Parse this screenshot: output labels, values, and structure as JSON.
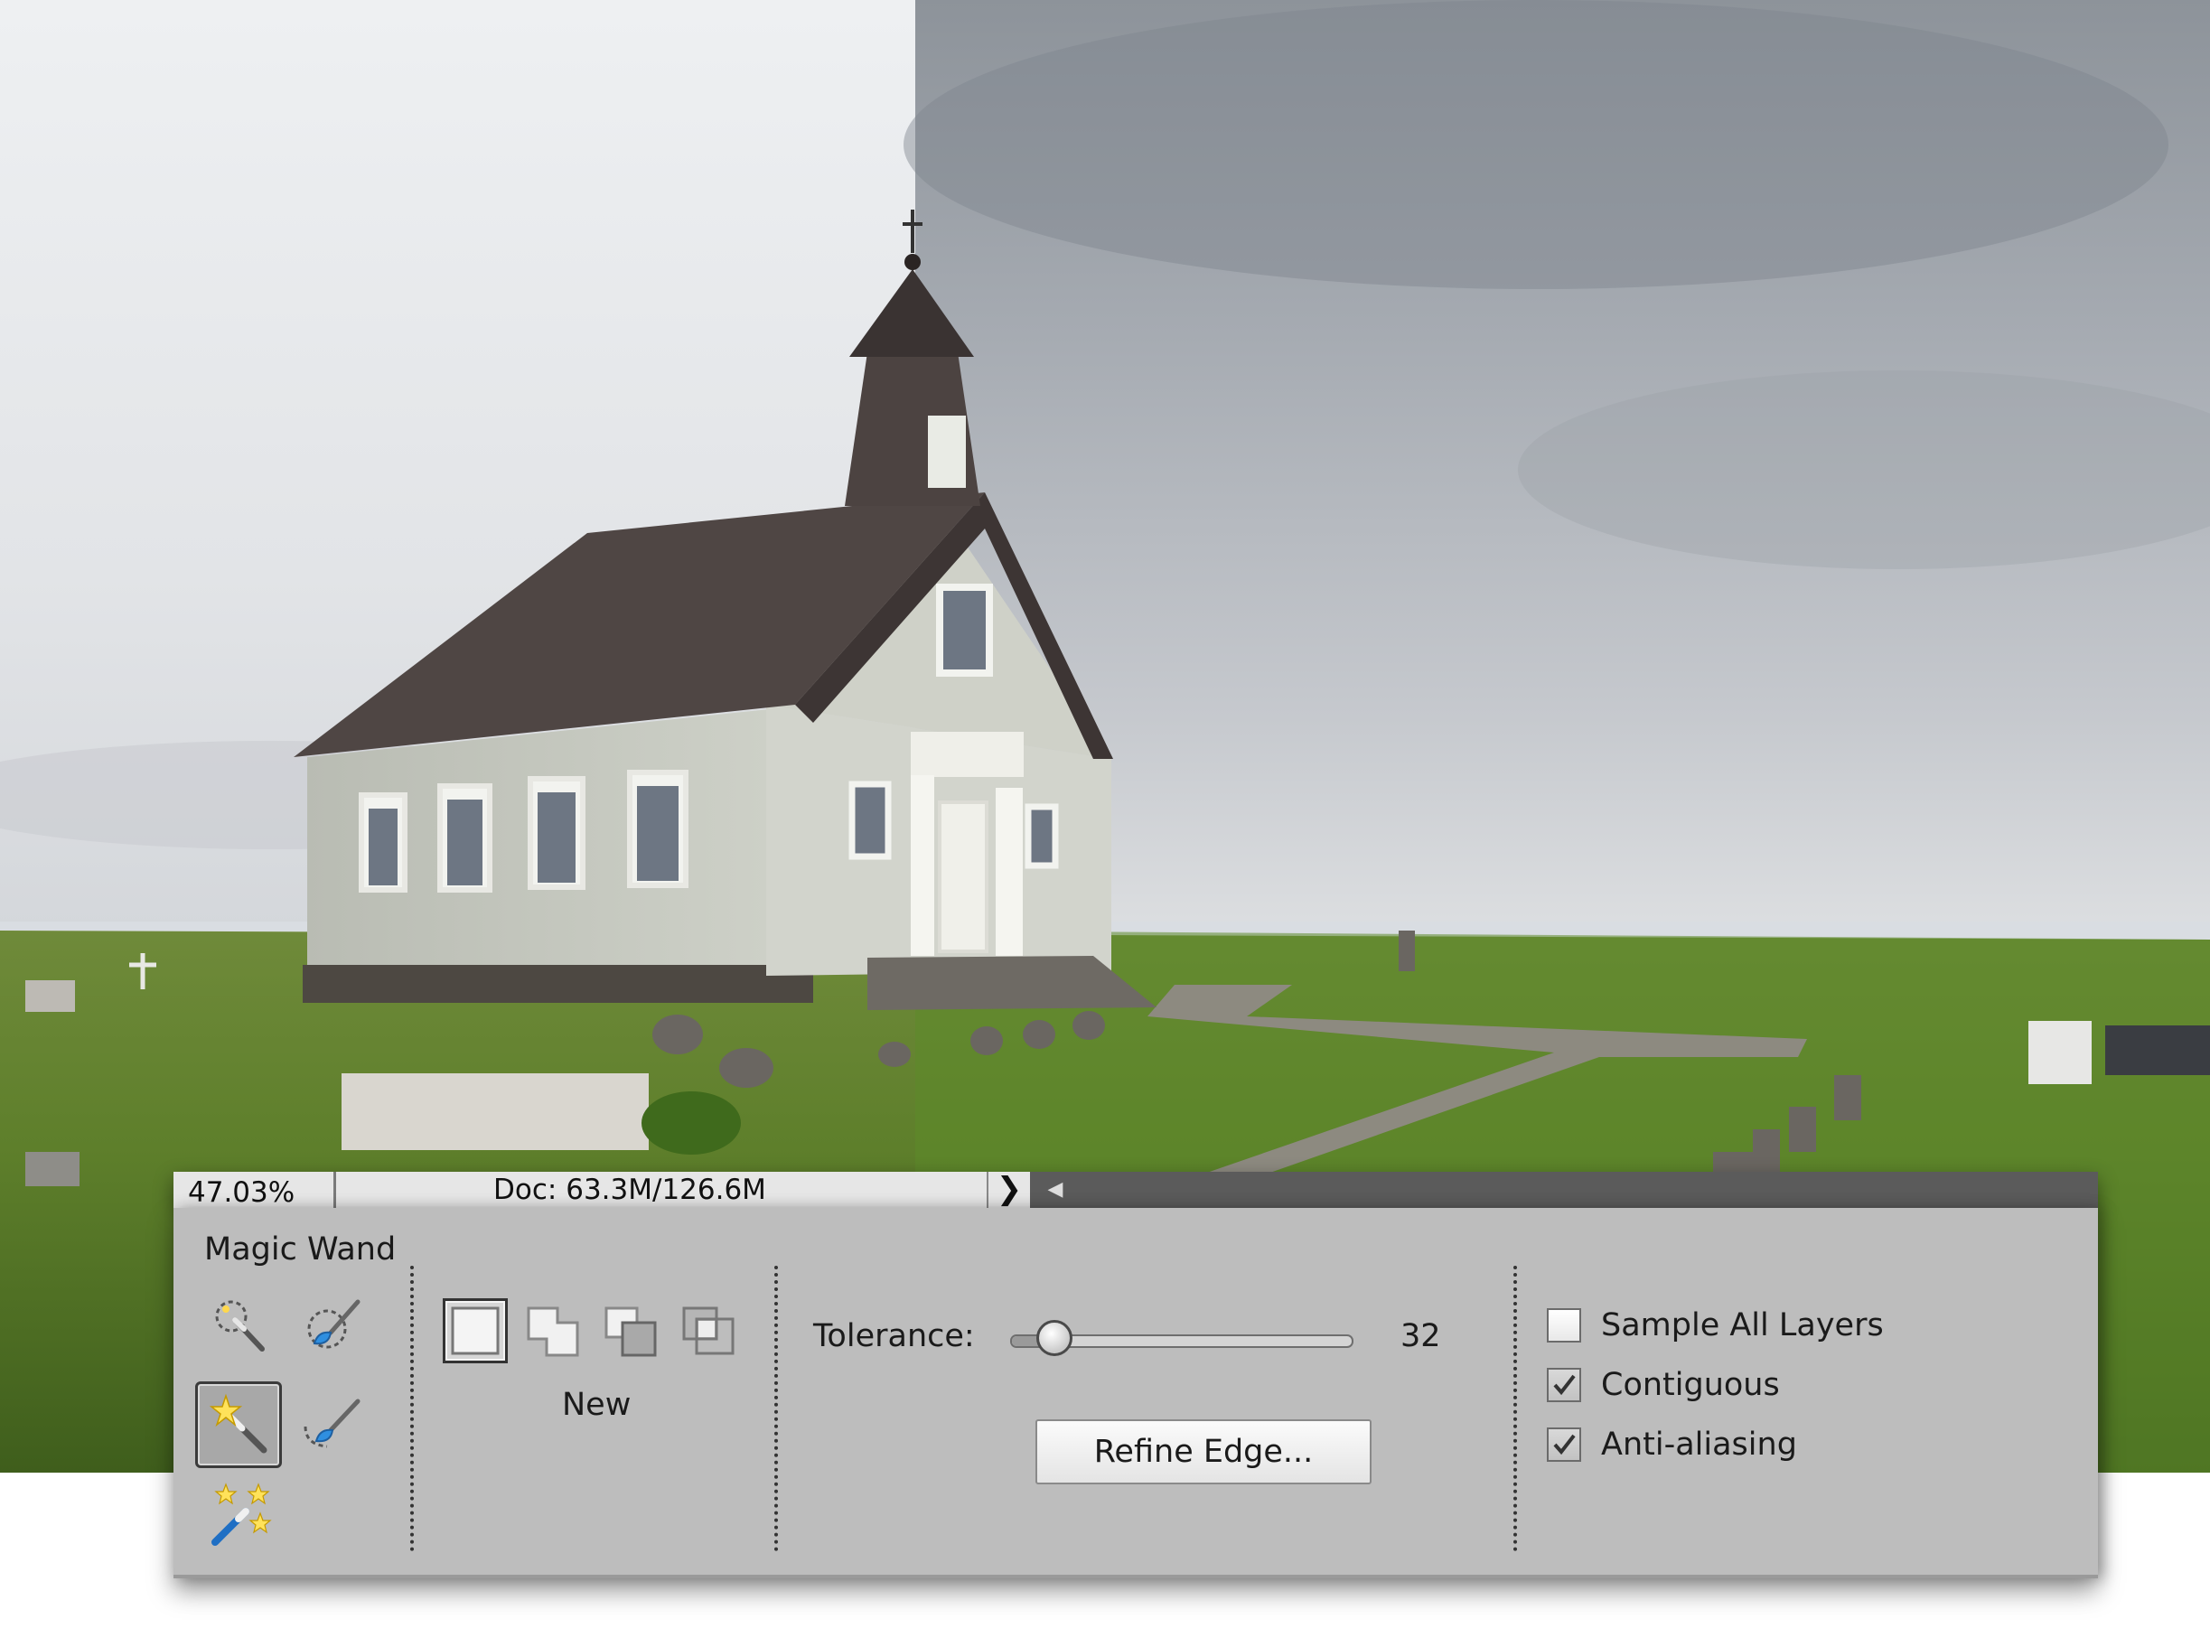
{
  "statusbar": {
    "zoom": "47.03%",
    "doc_size": "Doc: 63.3M/126.6M",
    "arrow": "❯",
    "scroll_arrow": "◀"
  },
  "options_bar": {
    "tool_name": "Magic Wand",
    "tools": [
      {
        "name": "quick-selection",
        "icon": "quick-selection-icon",
        "active": false
      },
      {
        "name": "selection-brush",
        "icon": "selection-brush-icon",
        "active": false
      },
      {
        "name": "magic-wand",
        "icon": "magic-wand-icon",
        "active": true
      },
      {
        "name": "refine-selection-brush",
        "icon": "refine-selection-brush-icon",
        "active": false
      },
      {
        "name": "auto-selection",
        "icon": "auto-selection-wand-icon",
        "active": false
      }
    ],
    "selection_modes": [
      {
        "name": "new",
        "icon": "new-selection-icon",
        "active": true
      },
      {
        "name": "add",
        "icon": "add-to-selection-icon",
        "active": false
      },
      {
        "name": "subtract",
        "icon": "subtract-from-selection-icon",
        "active": false
      },
      {
        "name": "intersect",
        "icon": "intersect-selection-icon",
        "active": false
      }
    ],
    "mode_label": "New",
    "tolerance": {
      "label": "Tolerance:",
      "value": "32",
      "min": 0,
      "max": 255
    },
    "refine_edge_label": "Refine Edge...",
    "checkboxes": [
      {
        "label": "Sample All Layers",
        "checked": false
      },
      {
        "label": "Contiguous",
        "checked": true
      },
      {
        "label": "Anti-aliasing",
        "checked": true
      }
    ]
  },
  "colors": {
    "panel_bg": "#bdbdbd",
    "statusbar_bg": "#5b5b5b",
    "field_bg": "#e6e6e6",
    "grass": "#56792a",
    "sky_left": "#e4e6e9",
    "sky_right": "#a9adb4"
  }
}
